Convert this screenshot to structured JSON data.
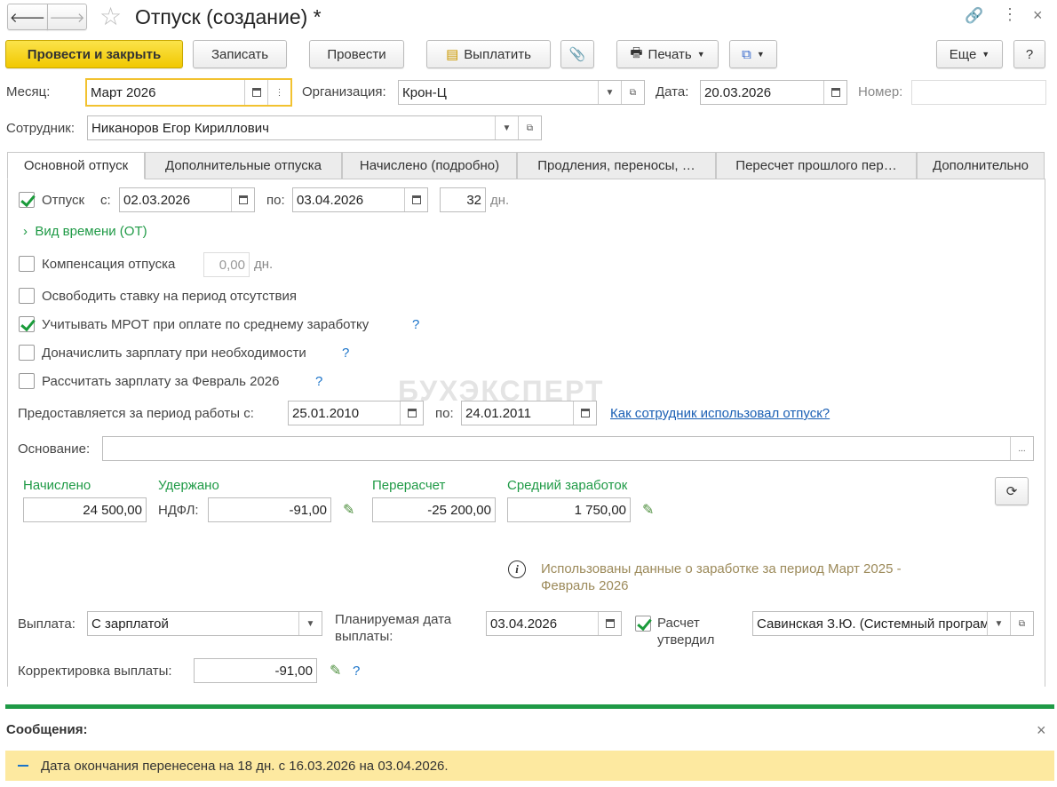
{
  "window": {
    "title": "Отпуск (создание) *"
  },
  "toolbar": {
    "post_close": "Провести и закрыть",
    "save": "Записать",
    "post": "Провести",
    "pay": "Выплатить",
    "print": "Печать",
    "more": "Еще",
    "help": "?"
  },
  "header": {
    "month_label": "Месяц:",
    "month_value": "Март 2026",
    "org_label": "Организация:",
    "org_value": "Крон-Ц",
    "date_label": "Дата:",
    "date_value": "20.03.2026",
    "number_label": "Номер:",
    "number_value": "",
    "employee_label": "Сотрудник:",
    "employee_value": "Никаноров Егор Кириллович"
  },
  "tabs": [
    "Основной отпуск",
    "Дополнительные отпуска",
    "Начислено (подробно)",
    "Продления, переносы, …",
    "Пересчет прошлого пер…",
    "Дополнительно"
  ],
  "main": {
    "vacation_label": "Отпуск",
    "from_label": "с:",
    "from_value": "02.03.2026",
    "to_label": "по:",
    "to_value": "03.04.2026",
    "days_value": "32",
    "days_unit": "дн.",
    "time_type": "Вид времени (ОТ)",
    "compensation_label": "Компенсация отпуска",
    "compensation_value": "0,00",
    "compensation_unit": "дн.",
    "free_rate": "Освободить ставку на период отсутствия",
    "mrot": "Учитывать МРОТ при оплате по среднему заработку",
    "accrue": "Доначислить зарплату при необходимости",
    "calc_salary": "Рассчитать зарплату за Февраль 2026",
    "period_label": "Предоставляется за период работы с:",
    "period_from": "25.01.2010",
    "period_to_label": "по:",
    "period_to": "24.01.2011",
    "usage_link": "Как сотрудник использовал отпуск?",
    "basis_label": "Основание:",
    "basis_value": "",
    "accrued_label": "Начислено",
    "accrued_value": "24 500,00",
    "withheld_label": "Удержано",
    "ndfl_label": "НДФЛ:",
    "ndfl_value": "-91,00",
    "recalc_label": "Перерасчет",
    "recalc_value": "-25 200,00",
    "avg_label": "Средний заработок",
    "avg_value": "1 750,00",
    "info_text": "Использованы данные о заработке за период Март 2025 - Февраль 2026",
    "payment_label": "Выплата:",
    "payment_value": "С зарплатой",
    "planned_date_label": "Планируемая дата выплаты:",
    "planned_date_value": "03.04.2026",
    "approved_label": "Расчет утвердил",
    "approved_value": "Савинская З.Ю. (Системный программист)",
    "correction_label": "Корректировка выплаты:",
    "correction_value": "-91,00"
  },
  "watermark": "БУХЭКСПЕРТ",
  "messages": {
    "title": "Сообщения:",
    "items": [
      "Дата окончания перенесена на 18 дн. с 16.03.2026 на 03.04.2026."
    ]
  },
  "colors": {
    "accent": "#f1c800",
    "green": "#1f9a46",
    "message_bg": "#fde9a0"
  }
}
